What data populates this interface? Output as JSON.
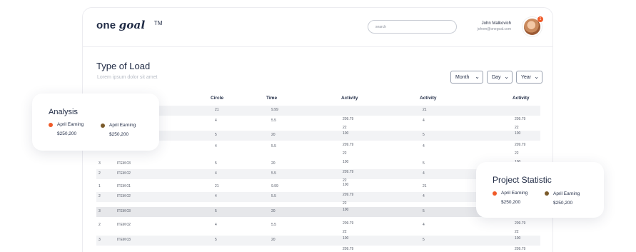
{
  "header": {
    "logo_one": "one",
    "logo_goal": "goal",
    "logo_tm": "TM",
    "search_placeholder": "search",
    "user_name": "John Malkovich",
    "user_email": "johnm@onegoal.com",
    "notification_count": "1"
  },
  "page": {
    "title": "Type of Load",
    "subtitle": "Lorem ipsum dolor sit amet",
    "filters": [
      "Month",
      "Day",
      "Year"
    ]
  },
  "table": {
    "headers": [
      "Circle",
      "Time",
      "Activity",
      "Activity",
      "Activity"
    ],
    "rows": [
      {
        "item": "",
        "circle": "21",
        "time": "9.99",
        "act1a": "",
        "act1b": "",
        "act2": "21",
        "act3a": "",
        "act3b": ""
      },
      {
        "item": "",
        "circle": "4",
        "time": "5.5",
        "act1a": "209.79",
        "act1b": "22",
        "act2": "4",
        "act3a": "209.79",
        "act3b": "22"
      },
      {
        "item": "",
        "circle": "5",
        "time": "20",
        "act1a": "100",
        "act1b": "",
        "act2": "5",
        "act3a": "100",
        "act3b": ""
      },
      {
        "num": "2",
        "item": "ITEM 02",
        "circle": "4",
        "time": "5.5",
        "act1a": "209.79",
        "act1b": "22",
        "act2": "4",
        "act3a": "209.79",
        "act3b": "22"
      },
      {
        "num": "3",
        "item": "ITEM 03",
        "circle": "5",
        "time": "20",
        "act1a": "100",
        "act1b": "",
        "act2": "5",
        "act3a": "100",
        "act3b": ""
      },
      {
        "num": "2",
        "item": "ITEM 02",
        "circle": "4",
        "time": "5.5",
        "act1a": "209.79",
        "act1b": "22",
        "act2": "4",
        "act3a": "",
        "act3b": ""
      },
      {
        "num": "1",
        "item": "ITEM 01",
        "circle": "21",
        "time": "9.99",
        "act1a": "100",
        "act1b": "",
        "act2": "21",
        "act3a": "",
        "act3b": ""
      },
      {
        "num": "2",
        "item": "ITEM 02",
        "circle": "4",
        "time": "5.5",
        "act1a": "209.79",
        "act1b": "22",
        "act2": "4",
        "act3a": "",
        "act3b": ""
      },
      {
        "num": "3",
        "item": "ITEM 03",
        "circle": "5",
        "time": "20",
        "act1a": "100",
        "act1b": "",
        "act2": "5",
        "act3a": "",
        "act3b": ""
      },
      {
        "num": "2",
        "item": "ITEM 02",
        "circle": "4",
        "time": "5.5",
        "act1a": "209.79",
        "act1b": "22",
        "act2": "4",
        "act3a": "209.79",
        "act3b": "22"
      },
      {
        "num": "3",
        "item": "ITEM 03",
        "circle": "5",
        "time": "20",
        "act1a": "100",
        "act1b": "",
        "act2": "5",
        "act3a": "100",
        "act3b": ""
      },
      {
        "num": "",
        "item": "",
        "circle": "",
        "time": "",
        "act1a": "209.79",
        "act1b": "",
        "act2": "",
        "act3a": "209.79",
        "act3b": ""
      }
    ]
  },
  "analysis_card": {
    "title": "Analysis",
    "items": [
      {
        "label": "April Earning",
        "value": "$250,200",
        "color": "#f05a28"
      },
      {
        "label": "April Earning",
        "value": "$250,200",
        "color": "#7a5a2a"
      }
    ]
  },
  "project_card": {
    "title": "Project Statistic",
    "items": [
      {
        "label": "April Earning",
        "value": "$250,200",
        "color": "#f05a28"
      },
      {
        "label": "April Earning",
        "value": "$250,200",
        "color": "#7a5a2a"
      }
    ]
  }
}
